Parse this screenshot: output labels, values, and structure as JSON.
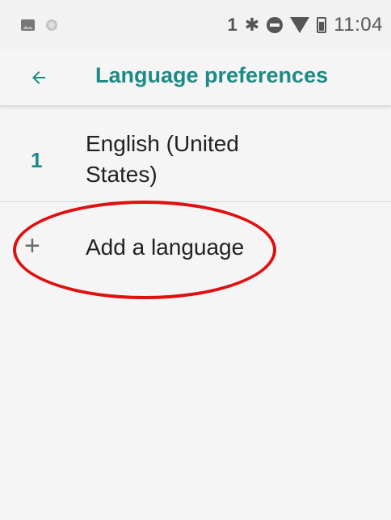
{
  "status_bar": {
    "sim_label": "1",
    "time": "11:04",
    "icons": [
      "image-icon",
      "circle-icon",
      "bluetooth-icon",
      "do-not-disturb-icon",
      "wifi-icon",
      "battery-icon"
    ]
  },
  "toolbar": {
    "title": "Language preferences",
    "back_icon": "arrow-left-icon",
    "accent_color": "#1e8a86"
  },
  "languages": [
    {
      "index": "1",
      "name": "English (United States)"
    }
  ],
  "add_language": {
    "label": "Add a language",
    "icon": "plus-icon"
  },
  "annotation": {
    "color": "#e01010",
    "shape": "ellipse"
  }
}
